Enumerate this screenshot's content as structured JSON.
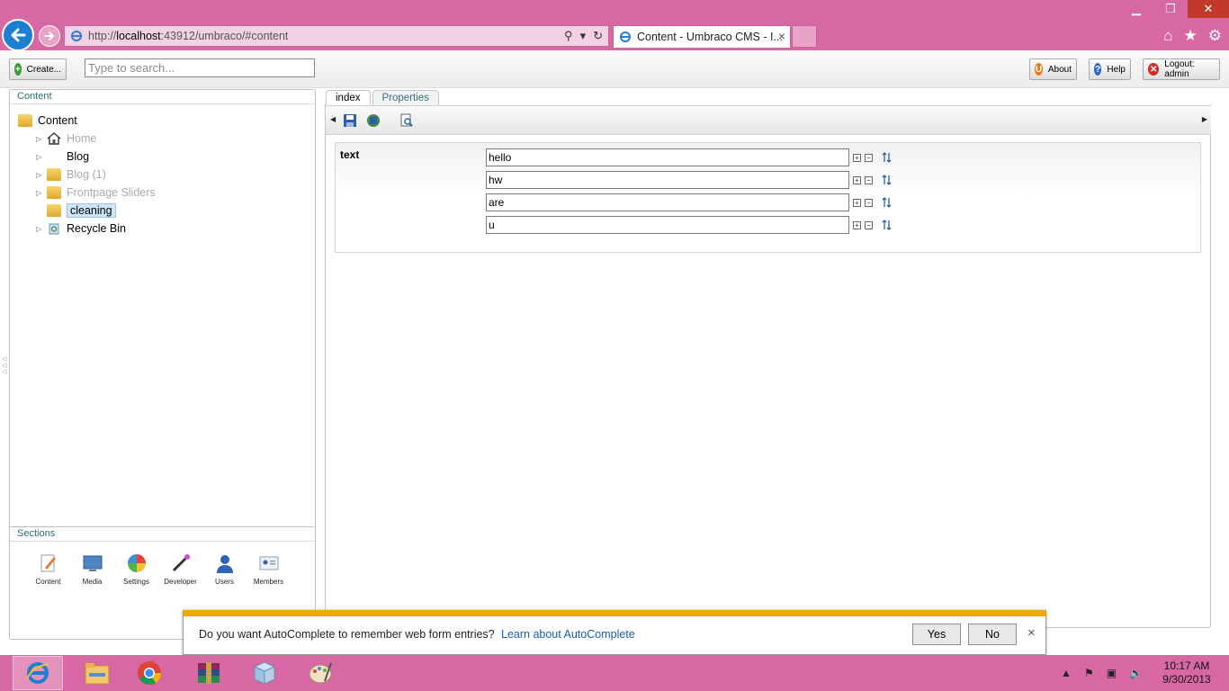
{
  "browser": {
    "url_prefix": "http://",
    "url_host": "localhost",
    "url_rest": ":43912/umbraco/#content",
    "tab_title": "Content - Umbraco CMS - I...",
    "tab_close": "×"
  },
  "topbar": {
    "create_label": "Create...",
    "search_placeholder": "Type to search...",
    "about_label": "About",
    "help_label": "Help",
    "logout_label": "Logout: admin"
  },
  "content_panel": {
    "title": "Content",
    "tree": [
      {
        "label": "Content",
        "muted": false
      },
      {
        "label": "Home",
        "muted": true
      },
      {
        "label": "Blog",
        "muted": false
      },
      {
        "label": "Blog (1)",
        "muted": true
      },
      {
        "label": "Frontpage Sliders",
        "muted": true
      },
      {
        "label": "cleaning",
        "muted": false
      },
      {
        "label": "Recycle Bin",
        "muted": false
      }
    ]
  },
  "sections_panel": {
    "title": "Sections",
    "items": [
      "Content",
      "Media",
      "Settings",
      "Developer",
      "Users",
      "Members"
    ]
  },
  "editor": {
    "tabs": [
      "index",
      "Properties"
    ],
    "property_label": "text",
    "fields": [
      "hello",
      "hw",
      "are",
      "u"
    ]
  },
  "autocomplete": {
    "message": "Do you want AutoComplete to remember web form entries?",
    "link": "Learn about AutoComplete",
    "yes": "Yes",
    "no": "No",
    "close": "×"
  },
  "taskbar": {
    "time": "10:17 AM",
    "date": "9/30/2013"
  },
  "colors": {
    "chrome": "#d868a4",
    "accent": "#1e7fd0",
    "ac_bar": "#f0a800"
  }
}
